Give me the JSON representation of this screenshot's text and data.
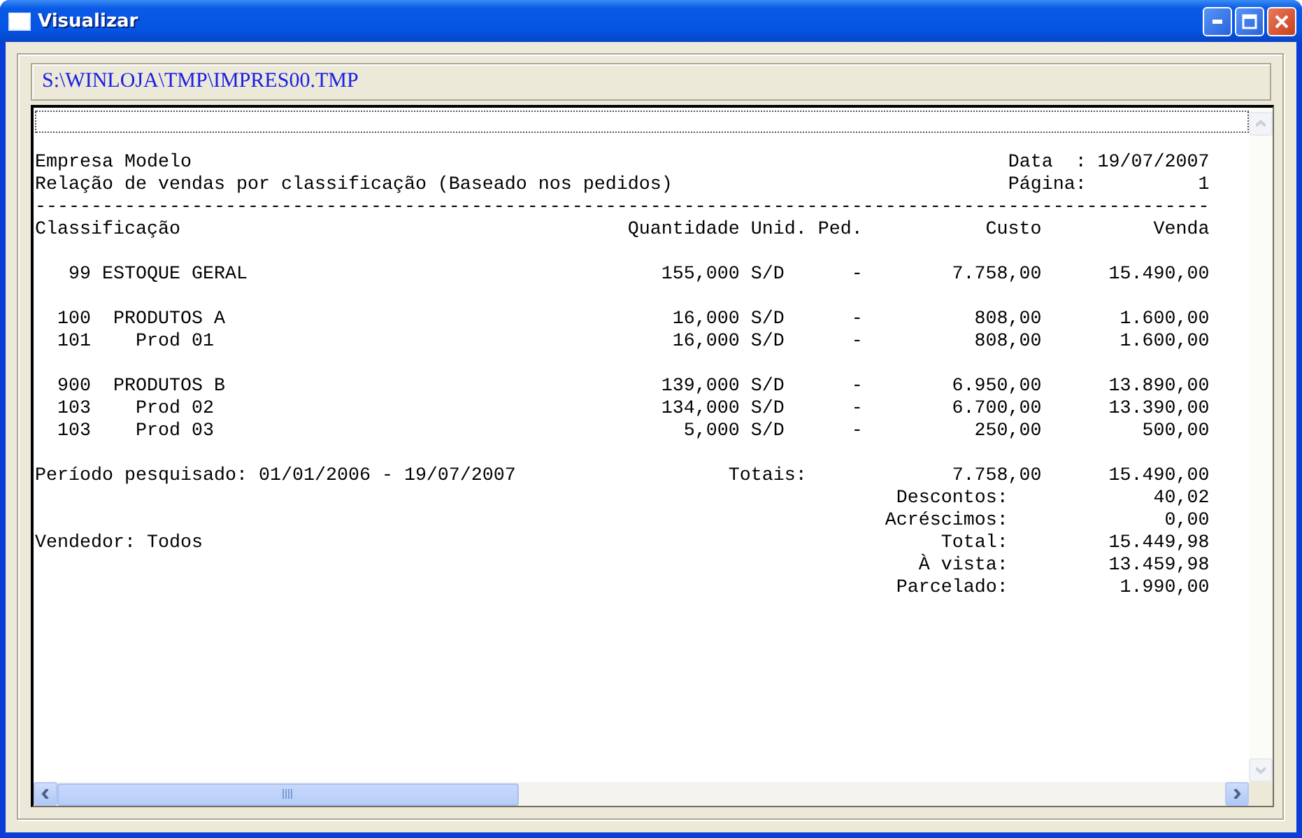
{
  "window": {
    "title": "Visualizar"
  },
  "file_path": "S:\\WINLOJA\\TMP\\IMPRES00.TMP",
  "report": {
    "company": "Empresa Modelo",
    "subtitle": "Relação de vendas por classificação (Baseado nos pedidos)",
    "date_label": "Data  :",
    "date": "19/07/2007",
    "page_label": "Página:",
    "page": "1",
    "separator": "---------------------------------------------------------------------------------------------------------",
    "columns": [
      "Classificação",
      "Quantidade",
      "Unid.",
      "Ped.",
      "Custo",
      "Venda"
    ],
    "rows": [
      {
        "code": "99",
        "name": "ESTOQUE GERAL",
        "quantity": "155,000",
        "unit": "S/D",
        "ped": "-",
        "cost": "7.758,00",
        "sale": "15.490,00",
        "children": [
          {
            "code": "100",
            "name": "PRODUTOS A",
            "quantity": "16,000",
            "unit": "S/D",
            "ped": "-",
            "cost": "808,00",
            "sale": "1.600,00",
            "children": [
              {
                "code": "101",
                "name": "Prod 01",
                "quantity": "16,000",
                "unit": "S/D",
                "ped": "-",
                "cost": "808,00",
                "sale": "1.600,00"
              }
            ]
          },
          {
            "code": "900",
            "name": "PRODUTOS B",
            "quantity": "139,000",
            "unit": "S/D",
            "ped": "-",
            "cost": "6.950,00",
            "sale": "13.890,00",
            "children": [
              {
                "code": "103",
                "name": "Prod 02",
                "quantity": "134,000",
                "unit": "S/D",
                "ped": "-",
                "cost": "6.700,00",
                "sale": "13.390,00"
              },
              {
                "code": "103",
                "name": "Prod 03",
                "quantity": "5,000",
                "unit": "S/D",
                "ped": "-",
                "cost": "250,00",
                "sale": "500,00"
              }
            ]
          }
        ]
      }
    ],
    "summary": [
      {
        "kind": "grand",
        "note": "Período pesquisado: 01/01/2006 - 19/07/2007",
        "label": "Totais:",
        "cost": "7.758,00",
        "sale": "15.490,00"
      },
      {
        "kind": "line",
        "label": "Descontos:",
        "sale": "40,02"
      },
      {
        "kind": "line",
        "label": "Acréscimos:",
        "sale": "0,00"
      },
      {
        "kind": "line",
        "note": "Vendedor: Todos",
        "label": "Total:",
        "sale": "15.449,98"
      },
      {
        "kind": "line",
        "label": "À vista:",
        "sale": "13.459,98"
      },
      {
        "kind": "line",
        "label": "Parcelado:",
        "sale": "1.990,00"
      }
    ]
  }
}
